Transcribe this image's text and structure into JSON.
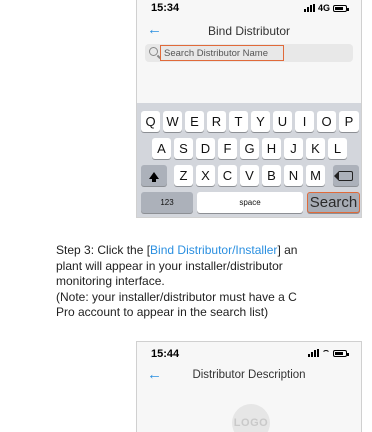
{
  "phone1": {
    "status": {
      "time": "15:34",
      "network": "4G"
    },
    "nav": {
      "title": "Bind Distributor"
    },
    "search": {
      "placeholder": "Search Distributor Name"
    },
    "keyboard": {
      "row1": [
        "Q",
        "W",
        "E",
        "R",
        "T",
        "Y",
        "U",
        "I",
        "O",
        "P"
      ],
      "row2": [
        "A",
        "S",
        "D",
        "F",
        "G",
        "H",
        "J",
        "K",
        "L"
      ],
      "row3": [
        "Z",
        "X",
        "C",
        "V",
        "B",
        "N",
        "M"
      ],
      "numbers": "123",
      "space": "space",
      "search": "Search"
    }
  },
  "instructions": {
    "line1_prefix": "Step 3: Click the [",
    "line1_link": "Bind Distributor/Installer",
    "line1_suffix": "] an",
    "line2": "plant will appear in your installer/distributor",
    "line3": "monitoring interface.",
    "line4": "(Note: your installer/distributor must have a C",
    "line5": "Pro account to appear in the search list)"
  },
  "phone2": {
    "status": {
      "time": "15:44"
    },
    "nav": {
      "title": "Distributor Description"
    },
    "logo": "LOGO"
  },
  "colors": {
    "accent": "#2a8fe0",
    "highlight": "#e06a3a"
  }
}
